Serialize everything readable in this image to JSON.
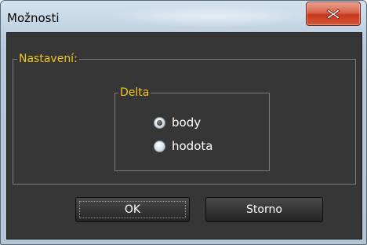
{
  "window": {
    "title": "Možnosti",
    "close_icon": "close-x-icon"
  },
  "settings_group": {
    "label": "Nastavení:"
  },
  "delta_group": {
    "label": "Delta",
    "options": [
      {
        "label": "body",
        "checked": true
      },
      {
        "label": "hodota",
        "checked": false
      }
    ]
  },
  "buttons": {
    "ok_label": "OK",
    "cancel_label": "Storno"
  },
  "colors": {
    "group_label": "#f0c419",
    "panel_bg": "#363636",
    "close_red": "#c7381e"
  }
}
